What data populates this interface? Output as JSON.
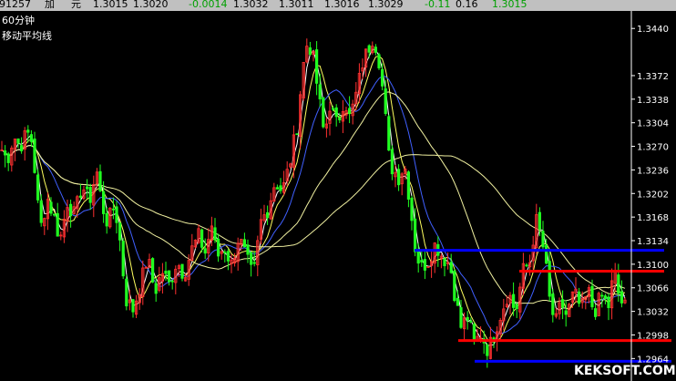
{
  "quote_bar": {
    "code": "91257",
    "field1": "加",
    "field2": "元",
    "open": "1.3015",
    "high": "1.3020",
    "change": "-0.0014",
    "low": "1.3032",
    "prev": "1.3011",
    "bid": "1.3016",
    "ask": "1.3029",
    "change_pct": "-0.11",
    "vol": "0.16",
    "last": "1.3015"
  },
  "chart_title": "60分钟",
  "indicator_label": "移动平均线",
  "watermark": "KEKSOFT.COM",
  "colors": {
    "background": "#000000",
    "axis": "#ffffff",
    "up_candle": "#ff3030",
    "down_candle": "#20ff20",
    "ma_short": "#ffffff",
    "ma_mid": "#ffff60",
    "ma_blue": "#4060ff",
    "ma_long": "#f0f0a0",
    "level_blue": "#0000ff",
    "level_red": "#ff0000"
  },
  "chart_data": {
    "type": "candlestick",
    "title": "",
    "xlabel": "",
    "ylabel": "",
    "ylim": [
      1.295,
      1.346
    ],
    "y_ticks": [
      "1.3440",
      "1.3372",
      "1.3338",
      "1.3304",
      "1.3270",
      "1.3236",
      "1.3202",
      "1.3168",
      "1.3134",
      "1.3100",
      "1.3066",
      "1.3032",
      "1.2998",
      "1.2964"
    ],
    "price_path": [
      [
        0,
        1.327
      ],
      [
        8,
        1.325
      ],
      [
        15,
        1.3285
      ],
      [
        22,
        1.327
      ],
      [
        30,
        1.329
      ],
      [
        36,
        1.3275
      ],
      [
        40,
        1.32
      ],
      [
        45,
        1.3155
      ],
      [
        52,
        1.3195
      ],
      [
        60,
        1.3165
      ],
      [
        66,
        1.3135
      ],
      [
        74,
        1.319
      ],
      [
        82,
        1.317
      ],
      [
        90,
        1.3215
      ],
      [
        98,
        1.319
      ],
      [
        106,
        1.3235
      ],
      [
        112,
        1.3185
      ],
      [
        118,
        1.316
      ],
      [
        126,
        1.3185
      ],
      [
        132,
        1.313
      ],
      [
        138,
        1.305
      ],
      [
        146,
        1.3035
      ],
      [
        154,
        1.307
      ],
      [
        162,
        1.311
      ],
      [
        170,
        1.306
      ],
      [
        178,
        1.309
      ],
      [
        186,
        1.307
      ],
      [
        194,
        1.3105
      ],
      [
        202,
        1.3085
      ],
      [
        210,
        1.312
      ],
      [
        218,
        1.314
      ],
      [
        226,
        1.3115
      ],
      [
        232,
        1.316
      ],
      [
        238,
        1.311
      ],
      [
        246,
        1.3125
      ],
      [
        254,
        1.31
      ],
      [
        262,
        1.314
      ],
      [
        270,
        1.311
      ],
      [
        278,
        1.308
      ],
      [
        286,
        1.316
      ],
      [
        294,
        1.318
      ],
      [
        302,
        1.322
      ],
      [
        310,
        1.3205
      ],
      [
        318,
        1.3245
      ],
      [
        326,
        1.33
      ],
      [
        332,
        1.338
      ],
      [
        338,
        1.3425
      ],
      [
        344,
        1.3395
      ],
      [
        350,
        1.334
      ],
      [
        356,
        1.3285
      ],
      [
        362,
        1.333
      ],
      [
        370,
        1.33
      ],
      [
        378,
        1.334
      ],
      [
        384,
        1.331
      ],
      [
        392,
        1.335
      ],
      [
        398,
        1.339
      ],
      [
        404,
        1.341
      ],
      [
        410,
        1.343
      ],
      [
        416,
        1.3395
      ],
      [
        422,
        1.333
      ],
      [
        426,
        1.326
      ],
      [
        430,
        1.324
      ],
      [
        438,
        1.3225
      ],
      [
        444,
        1.3245
      ],
      [
        450,
        1.319
      ],
      [
        456,
        1.312
      ],
      [
        462,
        1.3095
      ],
      [
        470,
        1.3105
      ],
      [
        478,
        1.313
      ],
      [
        486,
        1.311
      ],
      [
        494,
        1.31
      ],
      [
        500,
        1.305
      ],
      [
        506,
        1.301
      ],
      [
        514,
        1.3025
      ],
      [
        520,
        1.2985
      ],
      [
        528,
        1.3
      ],
      [
        536,
        1.2975
      ],
      [
        542,
        1.3
      ],
      [
        550,
        1.303
      ],
      [
        558,
        1.306
      ],
      [
        566,
        1.303
      ],
      [
        574,
        1.309
      ],
      [
        582,
        1.3105
      ],
      [
        588,
        1.3165
      ],
      [
        594,
        1.314
      ],
      [
        598,
        1.311
      ],
      [
        604,
        1.304
      ],
      [
        610,
        1.3015
      ],
      [
        616,
        1.3045
      ],
      [
        622,
        1.3025
      ],
      [
        630,
        1.306
      ],
      [
        638,
        1.3035
      ],
      [
        646,
        1.306
      ],
      [
        652,
        1.303
      ],
      [
        660,
        1.3055
      ],
      [
        668,
        1.304
      ],
      [
        674,
        1.309
      ],
      [
        680,
        1.305
      ],
      [
        688,
        1.3035
      ]
    ],
    "moving_averages": [
      {
        "color_key": "ma_short",
        "window": 3
      },
      {
        "color_key": "ma_mid",
        "window": 6
      },
      {
        "color_key": "ma_blue",
        "window": 12
      },
      {
        "color_key": "ma_long",
        "window": 30
      },
      {
        "color_key": "ma_long",
        "window": 60
      }
    ],
    "levels": [
      {
        "color_key": "level_blue",
        "price": 1.312,
        "x_start": 455,
        "x_end": 729
      },
      {
        "color_key": "level_red",
        "price": 1.309,
        "x_start": 570,
        "x_end": 729
      },
      {
        "color_key": "level_red",
        "price": 1.299,
        "x_start": 503,
        "x_end": 737
      },
      {
        "color_key": "level_blue",
        "price": 1.296,
        "x_start": 521,
        "x_end": 737
      }
    ]
  }
}
